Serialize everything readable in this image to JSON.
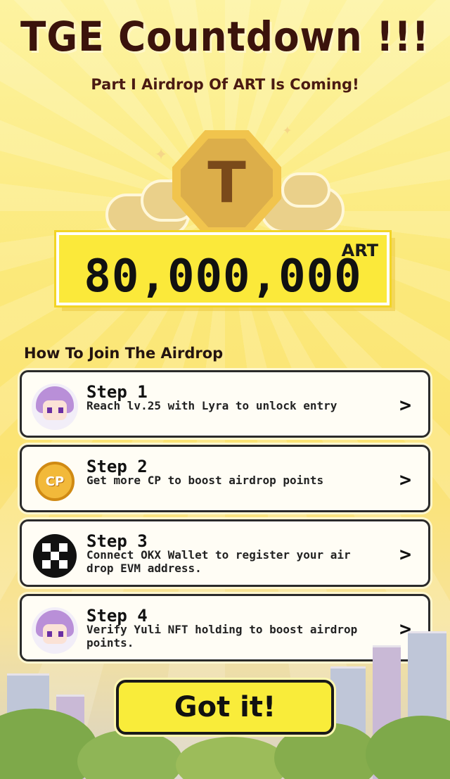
{
  "header": {
    "title": "TGE Countdown !!!",
    "subtitle": "Part I Airdrop Of ART Is Coming!"
  },
  "reward": {
    "unit": "ART",
    "amount": "80,000,000",
    "coin_glyph": "T"
  },
  "section": {
    "title": "How To Join The Airdrop"
  },
  "steps": [
    {
      "title": "Step 1",
      "description": "Reach lv.25 with Lyra to unlock entry",
      "icon": "lyra-avatar-icon"
    },
    {
      "title": "Step 2",
      "description": "Get more CP to boost airdrop points",
      "icon": "cp-coin-icon",
      "icon_text": "CP"
    },
    {
      "title": "Step 3",
      "description": "Connect OKX Wallet to register your air drop EVM address.",
      "icon": "okx-logo-icon"
    },
    {
      "title": "Step 4",
      "description": "Verify Yuli NFT holding to boost airdrop points.",
      "icon": "yuli-avatar-icon"
    }
  ],
  "chevron": ">",
  "button": {
    "label": "Got it!"
  },
  "colors": {
    "accent_yellow": "#f9ec3a",
    "title_brown": "#3b130c",
    "background": "#fbe97a"
  }
}
